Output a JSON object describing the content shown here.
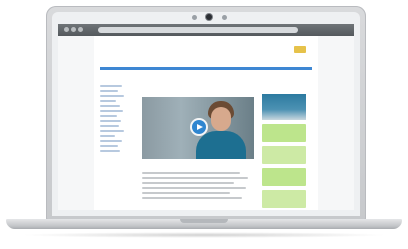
{
  "laptop": {
    "camera": "camera-icon"
  },
  "browser": {
    "url": ""
  },
  "site": {
    "logo_text": "",
    "nav": [
      "",
      "",
      "",
      ""
    ],
    "sidebar": {
      "title": "",
      "links_count": 14
    },
    "main": {
      "heading": "",
      "subheading": "",
      "video_play_icon": "play-icon"
    },
    "right_column": {
      "cards": 4
    }
  }
}
